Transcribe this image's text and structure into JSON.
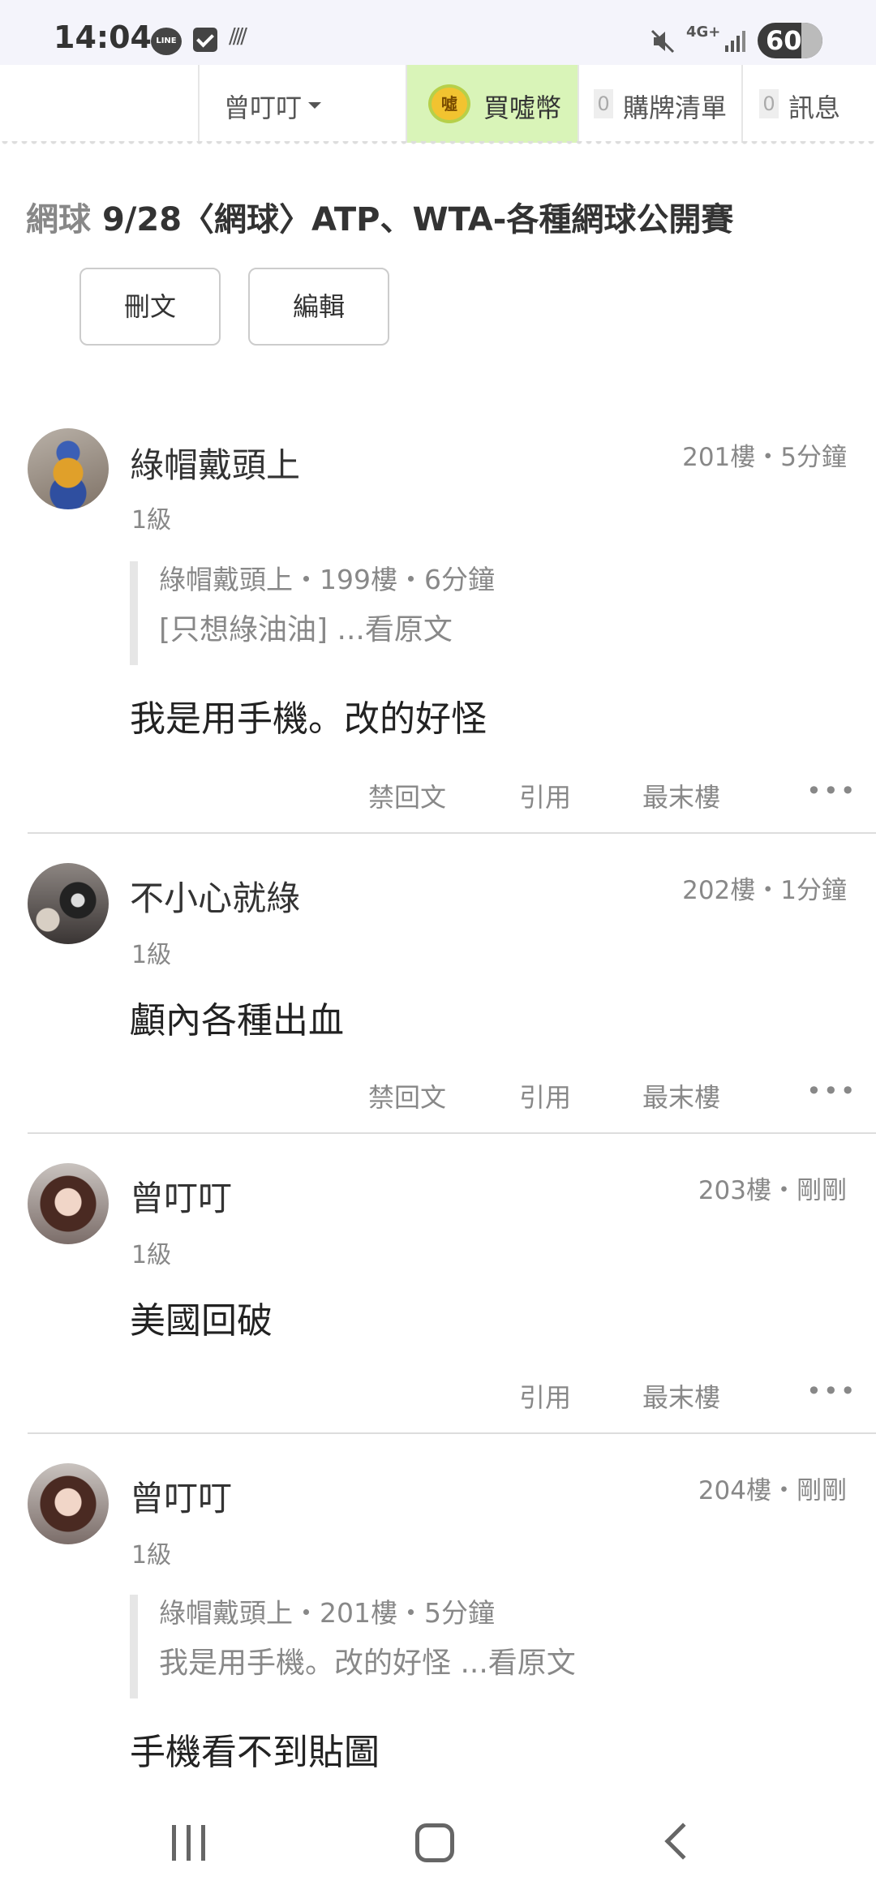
{
  "status_bar": {
    "time": "14:04",
    "icons": [
      "line-icon",
      "check-icon",
      "wave-icon",
      "mute-icon",
      "network-icon",
      "signal-icon",
      "battery-icon"
    ],
    "line_label": "LINE",
    "network": "4G+",
    "battery": "60"
  },
  "nav": {
    "user": "曾叮叮",
    "coin_icon_label": "噓",
    "coin": "買噓幣",
    "cart_count": "0",
    "cart": "購牌清單",
    "msg_count": "0",
    "messages": "訊息"
  },
  "thread": {
    "board": "網球",
    "title": "9/28〈網球〉ATP、WTA-各種網球公開賽",
    "delete_label": "刪文",
    "edit_label": "編輯"
  },
  "posts": [
    {
      "author": "綠帽戴頭上",
      "level": "1級",
      "floor": "201樓・5分鐘",
      "quote_meta": "綠帽戴頭上・199樓・6分鐘",
      "quote_text": "[只想綠油油] ...看原文",
      "body": "我是用手機。改的好怪",
      "actions": [
        "禁回文",
        "引用",
        "最末樓"
      ]
    },
    {
      "author": "不小心就綠",
      "level": "1級",
      "floor": "202樓・1分鐘",
      "body": "顱內各種出血",
      "actions": [
        "禁回文",
        "引用",
        "最末樓"
      ]
    },
    {
      "author": "曾叮叮",
      "level": "1級",
      "floor": "203樓・剛剛",
      "body": "美國回破",
      "actions": [
        "引用",
        "最末樓"
      ]
    },
    {
      "author": "曾叮叮",
      "level": "1級",
      "floor": "204樓・剛剛",
      "quote_meta": "綠帽戴頭上・201樓・5分鐘",
      "quote_text": "我是用手機。改的好怪 ...看原文",
      "body": "手機看不到貼圖"
    }
  ],
  "more_symbol": "•••",
  "system_nav": [
    "recents-icon",
    "home-icon",
    "back-icon"
  ]
}
